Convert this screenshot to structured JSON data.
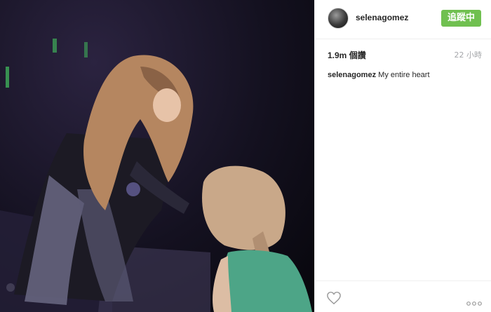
{
  "post": {
    "photo_icon": "concert-photo",
    "header": {
      "avatar_icon": "profile-avatar",
      "username": "selenagomez",
      "follow_label": "追蹤中",
      "follow_color": "#70c050"
    },
    "stats": {
      "views_count": "1.9m",
      "views_label": "個讚",
      "time": "22 小時"
    },
    "caption": {
      "username": "selenagomez",
      "text": "My entire heart"
    },
    "footer": {
      "like_icon": "heart-icon",
      "more_icon": "more-options-icon"
    }
  }
}
